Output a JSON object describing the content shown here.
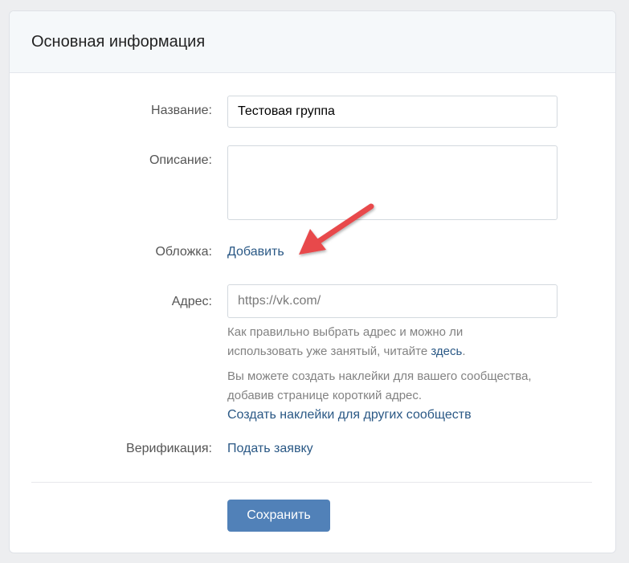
{
  "header": {
    "title": "Основная информация"
  },
  "form": {
    "name": {
      "label": "Название:",
      "value": "Тестовая группа"
    },
    "description": {
      "label": "Описание:",
      "value": ""
    },
    "cover": {
      "label": "Обложка:",
      "action": "Добавить"
    },
    "address": {
      "label": "Адрес:",
      "placeholder": "https://vk.com/",
      "hint_line1": "Как правильно выбрать адрес и можно ли",
      "hint_line2_prefix": "использовать уже занятый, читайте ",
      "hint_link": "здесь",
      "hint_line2_suffix": ".",
      "stickers_line1": "Вы можете создать наклейки для вашего сообщества,",
      "stickers_line2": "добавив странице короткий адрес.",
      "stickers_link": "Создать наклейки для других сообществ"
    },
    "verification": {
      "label": "Верификация:",
      "action": "Подать заявку"
    },
    "save_label": "Сохранить"
  },
  "colors": {
    "link": "#2a5885",
    "button": "#5181b8",
    "annotation_arrow": "#e8484b"
  },
  "icons": {
    "annotation": "arrow-pointer-icon"
  }
}
